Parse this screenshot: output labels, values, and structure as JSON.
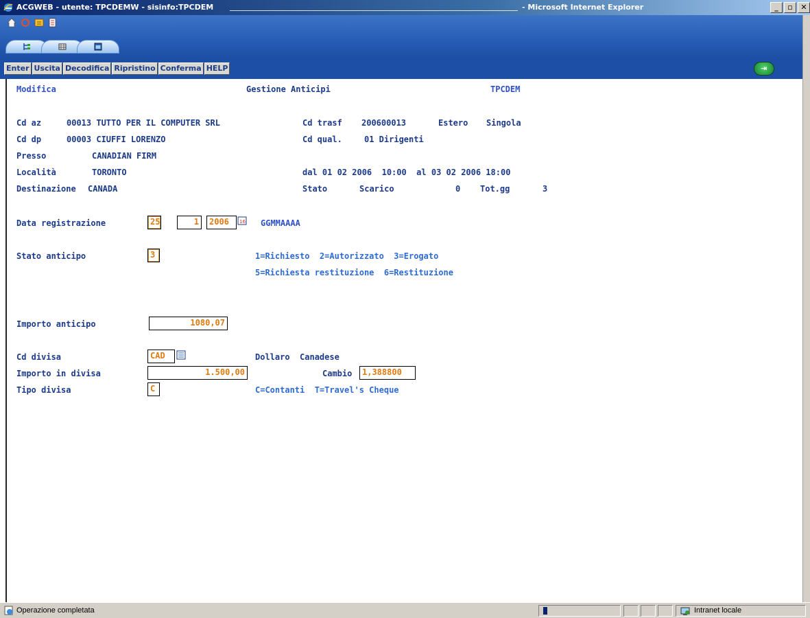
{
  "window": {
    "title": "ACGWEB - utente: TPCDEMW - sisinfo:TPCDEM",
    "browser": "- Microsoft Internet Explorer",
    "controls": [
      "_",
      "¿",
      "x"
    ]
  },
  "toolbar": {
    "app_icons": [
      "home-icon",
      "refresh-icon",
      "favorites-icon",
      "print-icon"
    ],
    "view_tabs": [
      "tree-view-icon",
      "grid-view-icon",
      "window-view-icon"
    ]
  },
  "function_keys": [
    "Enter",
    "Uscita",
    "Decodifica",
    "Ripristino",
    "Conferma",
    "HELP"
  ],
  "header": {
    "mode": "Modifica",
    "screen_title": "Gestione Anticipi",
    "program": "TPCDEM"
  },
  "info": {
    "cd_az_label": "Cd az",
    "cd_az_value": "00013 TUTTO PER IL COMPUTER SRL",
    "cd_trasf_label": "Cd trasf",
    "cd_trasf_value": "200600013",
    "estero": "Estero",
    "singola": "Singola",
    "cd_dp_label": "Cd dp",
    "cd_dp_value": "00003 CIUFFI LORENZO",
    "cd_qual_label": "Cd qual.",
    "cd_qual_value": "01 Dirigenti",
    "presso_label": "Presso",
    "presso_value": "CANADIAN FIRM",
    "localita_label": "Località",
    "localita_value": "TORONTO",
    "period": "dal 01 02 2006  10:00  al 03 02 2006 18:00",
    "destinazione_label": "Destinazione",
    "destinazione_value": "CANADA",
    "stato_label": "Stato",
    "scarico_label": "Scarico",
    "scarico_value": "0",
    "totgg_label": "Tot.gg",
    "totgg_value": "3"
  },
  "form": {
    "data_reg_label": "Data registrazione",
    "data_reg_day": "25",
    "data_reg_month": "1",
    "data_reg_year": "2006",
    "data_reg_format": "GGMMAAAA",
    "stato_anticipo_label": "Stato anticipo",
    "stato_anticipo_value": "3",
    "stato_options_line1": "1=Richiesto  2=Autorizzato  3=Erogato",
    "stato_options_line2": "5=Richiesta restituzione  6=Restituzione",
    "importo_anticipo_label": "Importo anticipo",
    "importo_anticipo_value": "1080,07",
    "cd_divisa_label": "Cd divisa",
    "cd_divisa_value": "CAD",
    "divisa_description": "Dollaro  Canadese",
    "importo_divisa_label": "Importo in divisa",
    "importo_divisa_value": "1.500,00",
    "cambio_label": "Cambio",
    "cambio_value": "1,388800",
    "tipo_divisa_label": "Tipo divisa",
    "tipo_divisa_value": "C",
    "tipo_divisa_options": "C=Contanti  T=Travel's Cheque"
  },
  "status": {
    "text": "Operazione completata",
    "zone": "Intranet locale"
  }
}
